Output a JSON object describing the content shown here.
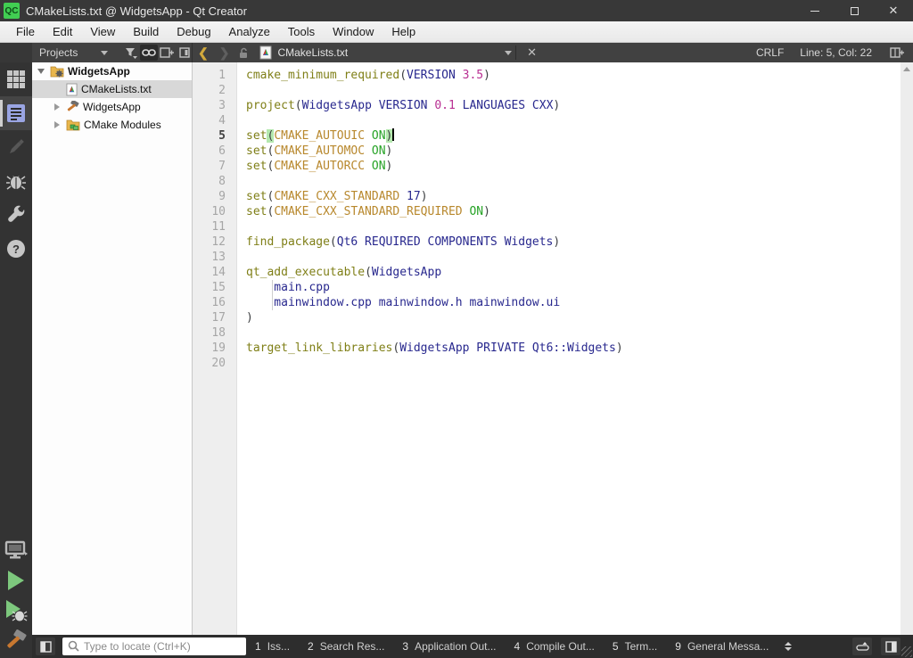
{
  "window": {
    "title": "CMakeLists.txt @ WidgetsApp - Qt Creator",
    "logo_text": "QC"
  },
  "menu": {
    "items": [
      "File",
      "Edit",
      "View",
      "Build",
      "Debug",
      "Analyze",
      "Tools",
      "Window",
      "Help"
    ]
  },
  "projects_toolbar": {
    "selector_label": "Projects"
  },
  "editor_toolbar": {
    "open_document_label": "CMakeLists.txt",
    "line_ending": "CRLF",
    "cursor_position": "Line: 5, Col: 22"
  },
  "projects_tree": {
    "rows": [
      {
        "label": "WidgetsApp",
        "icon": "folder-gear",
        "expanded": true,
        "selected": false
      },
      {
        "label": "CMakeLists.txt",
        "icon": "cmake-file",
        "selected": true
      },
      {
        "label": "WidgetsApp",
        "icon": "hammer",
        "expanded": false,
        "selected": false
      },
      {
        "label": "CMake Modules",
        "icon": "folder-modules",
        "expanded": false,
        "selected": false
      }
    ]
  },
  "editor": {
    "current_line": 5,
    "lines": [
      {
        "n": 1,
        "segs": [
          {
            "t": "cmake_minimum_required",
            "c": "cmd"
          },
          {
            "t": "(",
            "c": "p"
          },
          {
            "t": "VERSION ",
            "c": "arg"
          },
          {
            "t": "3.5",
            "c": "num"
          },
          {
            "t": ")",
            "c": "p"
          }
        ]
      },
      {
        "n": 2,
        "segs": []
      },
      {
        "n": 3,
        "segs": [
          {
            "t": "project",
            "c": "cmd"
          },
          {
            "t": "(",
            "c": "p"
          },
          {
            "t": "WidgetsApp VERSION ",
            "c": "arg"
          },
          {
            "t": "0.1",
            "c": "num"
          },
          {
            "t": " LANGUAGES CXX",
            "c": "arg"
          },
          {
            "t": ")",
            "c": "p"
          }
        ]
      },
      {
        "n": 4,
        "segs": []
      },
      {
        "n": 5,
        "segs": [
          {
            "t": "set",
            "c": "cmd"
          },
          {
            "t": "(",
            "c": "pm"
          },
          {
            "t": "CMAKE_AUTOUIC",
            "c": "var"
          },
          {
            "t": " ",
            "c": "d"
          },
          {
            "t": "ON",
            "c": "kw"
          },
          {
            "t": ")",
            "c": "pm"
          }
        ],
        "caret": true
      },
      {
        "n": 6,
        "segs": [
          {
            "t": "set",
            "c": "cmd"
          },
          {
            "t": "(",
            "c": "p"
          },
          {
            "t": "CMAKE_AUTOMOC",
            "c": "var"
          },
          {
            "t": " ",
            "c": "d"
          },
          {
            "t": "ON",
            "c": "kw"
          },
          {
            "t": ")",
            "c": "p"
          }
        ]
      },
      {
        "n": 7,
        "segs": [
          {
            "t": "set",
            "c": "cmd"
          },
          {
            "t": "(",
            "c": "p"
          },
          {
            "t": "CMAKE_AUTORCC",
            "c": "var"
          },
          {
            "t": " ",
            "c": "d"
          },
          {
            "t": "ON",
            "c": "kw"
          },
          {
            "t": ")",
            "c": "p"
          }
        ]
      },
      {
        "n": 8,
        "segs": []
      },
      {
        "n": 9,
        "segs": [
          {
            "t": "set",
            "c": "cmd"
          },
          {
            "t": "(",
            "c": "p"
          },
          {
            "t": "CMAKE_CXX_STANDARD",
            "c": "var"
          },
          {
            "t": " 17",
            "c": "arg"
          },
          {
            "t": ")",
            "c": "p"
          }
        ]
      },
      {
        "n": 10,
        "segs": [
          {
            "t": "set",
            "c": "cmd"
          },
          {
            "t": "(",
            "c": "p"
          },
          {
            "t": "CMAKE_CXX_STANDARD_REQUIRED",
            "c": "var"
          },
          {
            "t": " ",
            "c": "d"
          },
          {
            "t": "ON",
            "c": "kw"
          },
          {
            "t": ")",
            "c": "p"
          }
        ]
      },
      {
        "n": 11,
        "segs": []
      },
      {
        "n": 12,
        "segs": [
          {
            "t": "find_package",
            "c": "cmd"
          },
          {
            "t": "(",
            "c": "p"
          },
          {
            "t": "Qt6 REQUIRED COMPONENTS Widgets",
            "c": "arg"
          },
          {
            "t": ")",
            "c": "p"
          }
        ]
      },
      {
        "n": 13,
        "segs": []
      },
      {
        "n": 14,
        "segs": [
          {
            "t": "qt_add_executable",
            "c": "cmd"
          },
          {
            "t": "(",
            "c": "p"
          },
          {
            "t": "WidgetsApp",
            "c": "arg"
          }
        ]
      },
      {
        "n": 15,
        "segs": [
          {
            "t": "    main.cpp",
            "c": "arg"
          }
        ]
      },
      {
        "n": 16,
        "segs": [
          {
            "t": "    mainwindow.cpp mainwindow.h mainwindow.ui",
            "c": "arg"
          }
        ]
      },
      {
        "n": 17,
        "segs": [
          {
            "t": ")",
            "c": "p"
          }
        ]
      },
      {
        "n": 18,
        "segs": []
      },
      {
        "n": 19,
        "segs": [
          {
            "t": "target_link_libraries",
            "c": "cmd"
          },
          {
            "t": "(",
            "c": "p"
          },
          {
            "t": "WidgetsApp PRIVATE Qt6::Widgets",
            "c": "arg"
          },
          {
            "t": ")",
            "c": "p"
          }
        ]
      },
      {
        "n": 20,
        "segs": []
      }
    ]
  },
  "bottom_bar": {
    "locate_placeholder": "Type to locate (Ctrl+K)",
    "panes": [
      {
        "num": "1",
        "label": "Iss..."
      },
      {
        "num": "2",
        "label": "Search Res..."
      },
      {
        "num": "3",
        "label": "Application Out..."
      },
      {
        "num": "4",
        "label": "Compile Out..."
      },
      {
        "num": "5",
        "label": "Term..."
      },
      {
        "num": "9",
        "label": "General Messa..."
      }
    ]
  },
  "colors": {
    "accent_green": "#41cd52",
    "cmd": "#7f7f17",
    "variable": "#b8882d",
    "keyword_on": "#27a327",
    "number": "#b82f92",
    "argument": "#28288e",
    "paren_match_bg": "#b4e8ae"
  }
}
